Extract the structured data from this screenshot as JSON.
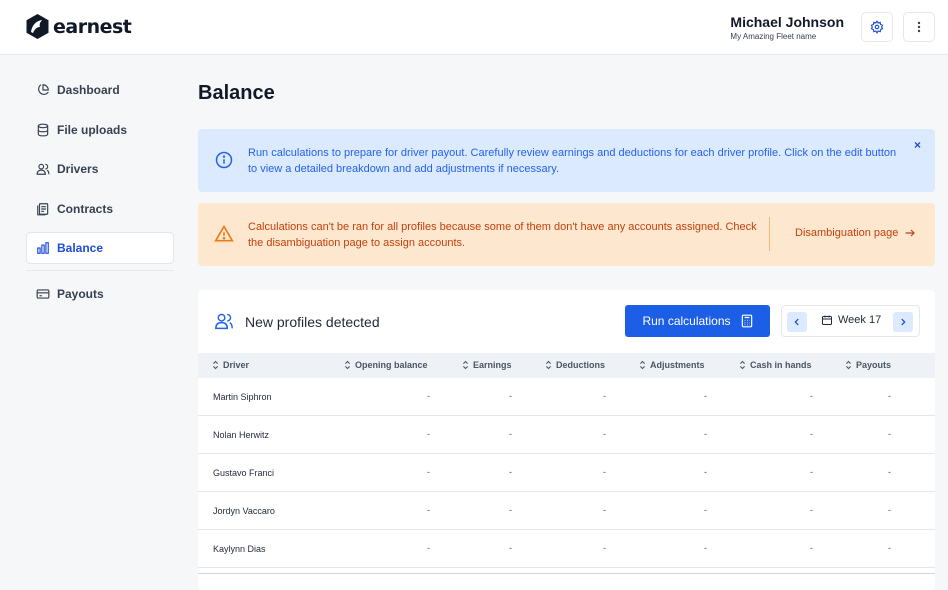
{
  "brand": {
    "name": "earnest"
  },
  "user": {
    "name": "Michael Johnson",
    "fleet": "My Amazing Fleet name"
  },
  "sidebar": {
    "items": [
      {
        "label": "Dashboard",
        "icon": "pie-chart-icon"
      },
      {
        "label": "File uploads",
        "icon": "database-icon"
      },
      {
        "label": "Drivers",
        "icon": "users-icon"
      },
      {
        "label": "Contracts",
        "icon": "documents-icon"
      },
      {
        "label": "Balance",
        "icon": "bar-chart-icon",
        "active": true
      },
      {
        "label": "Payouts",
        "icon": "credit-card-icon"
      }
    ]
  },
  "page": {
    "title": "Balance"
  },
  "info_banner": {
    "text": "Run calculations to prepare for driver payout. Carefully review earnings and deductions for each driver profile. Click on the edit button to view a detailed breakdown and add adjustments if necessary.",
    "close": "×"
  },
  "warning_banner": {
    "text": "Calculations can't be ran for all profiles because some of them don't have any accounts assigned. Check the disambiguation page to assign accounts.",
    "link_label": "Disambiguation page"
  },
  "profiles": {
    "title": "New profiles detected",
    "run_button": "Run calculations",
    "week_label": "Week 17",
    "columns": [
      "Driver",
      "Opening balance",
      "Earnings",
      "Deductions",
      "Adjustments",
      "Cash in hands",
      "Payouts"
    ],
    "rows": [
      {
        "driver": "Martin Siphron",
        "opening_balance": "-",
        "earnings": "-",
        "deductions": "-",
        "adjustments": "-",
        "cash_in_hands": "-",
        "payouts": "-"
      },
      {
        "driver": "Nolan Herwitz",
        "opening_balance": "-",
        "earnings": "-",
        "deductions": "-",
        "adjustments": "-",
        "cash_in_hands": "-",
        "payouts": "-"
      },
      {
        "driver": "Gustavo Franci",
        "opening_balance": "-",
        "earnings": "-",
        "deductions": "-",
        "adjustments": "-",
        "cash_in_hands": "-",
        "payouts": "-"
      },
      {
        "driver": "Jordyn Vaccaro",
        "opening_balance": "-",
        "earnings": "-",
        "deductions": "-",
        "adjustments": "-",
        "cash_in_hands": "-",
        "payouts": "-"
      },
      {
        "driver": "Kaylynn Dias",
        "opening_balance": "-",
        "earnings": "-",
        "deductions": "-",
        "adjustments": "-",
        "cash_in_hands": "-",
        "payouts": "-"
      }
    ]
  },
  "colors": {
    "accent": "#1d5ee6",
    "info_bg": "#dbeafe",
    "warning_bg": "#fde8cf",
    "warning_text": "#c2410c"
  }
}
